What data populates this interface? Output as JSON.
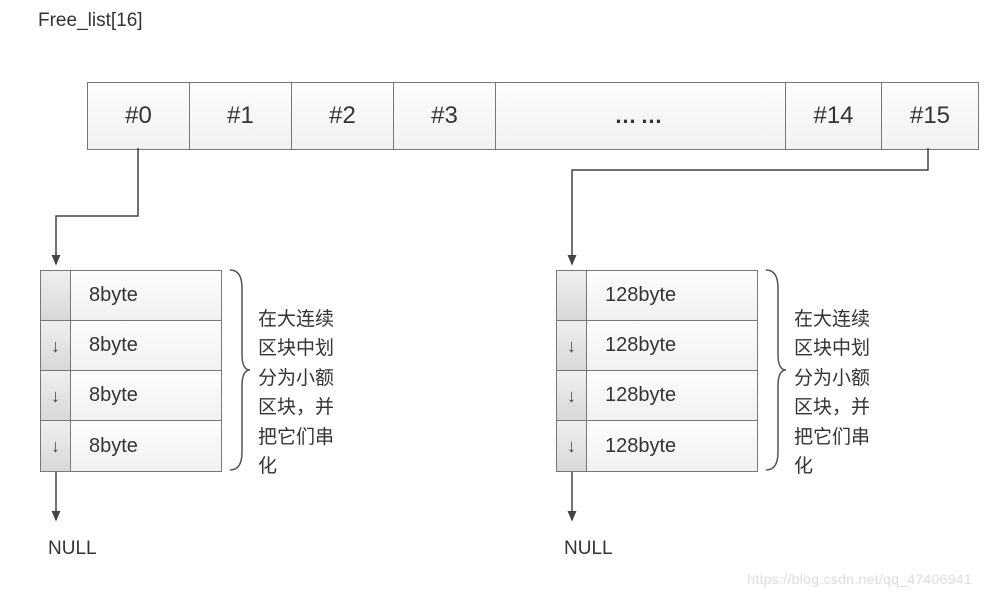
{
  "title": "Free_list[16]",
  "array": {
    "cells": [
      "#0",
      "#1",
      "#2",
      "#3",
      "……",
      "#14",
      "#15"
    ]
  },
  "group0": {
    "rows": [
      "8byte",
      "8byte",
      "8byte",
      "8byte"
    ],
    "caption": "在大连续区块中划分为小额区块，并把它们串化",
    "null": "NULL"
  },
  "group15": {
    "rows": [
      "128byte",
      "128byte",
      "128byte",
      "128byte"
    ],
    "caption": "在大连续区块中划分为小额区块，并把它们串化",
    "null": "NULL"
  },
  "watermark": "https://blog.csdn.net/qq_47406941"
}
